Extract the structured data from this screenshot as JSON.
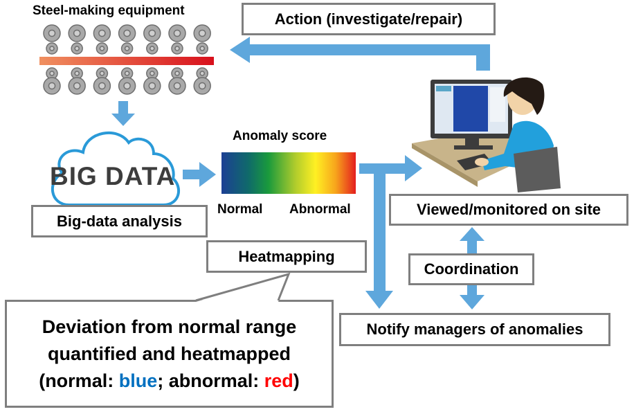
{
  "equipment": {
    "title": "Steel-making equipment",
    "roller_columns": 7
  },
  "action_box": {
    "label": "Action (investigate/repair)"
  },
  "cloud": {
    "text": "BIG DATA"
  },
  "bigdata_box": {
    "label": "Big-data analysis"
  },
  "anomaly": {
    "title": "Anomaly score",
    "low_label": "Normal",
    "high_label": "Abnormal",
    "gradient_colors": [
      "#1c3f94",
      "#0f7a5a",
      "#1a9a3c",
      "#a8c830",
      "#fff023",
      "#f7a51c",
      "#e41e1e"
    ]
  },
  "heatmapping_box": {
    "label": "Heatmapping"
  },
  "callout": {
    "line1": "Deviation from normal range",
    "line2": "quantified and heatmapped",
    "line3_prefix": "(normal: ",
    "line3_blue": "blue",
    "line3_mid": "; abnormal: ",
    "line3_red": "red",
    "line3_suffix": ")",
    "blue_color": "#0070c0",
    "red_color": "#ff0000"
  },
  "viewed_box": {
    "label": "Viewed/monitored on site"
  },
  "coordination_box": {
    "label": "Coordination"
  },
  "notify_box": {
    "label": "Notify managers of anomalies"
  },
  "colors": {
    "arrow": "#5ea7dc",
    "box_border": "#7f7f7f",
    "cloud_stroke": "#2a9ad8"
  }
}
